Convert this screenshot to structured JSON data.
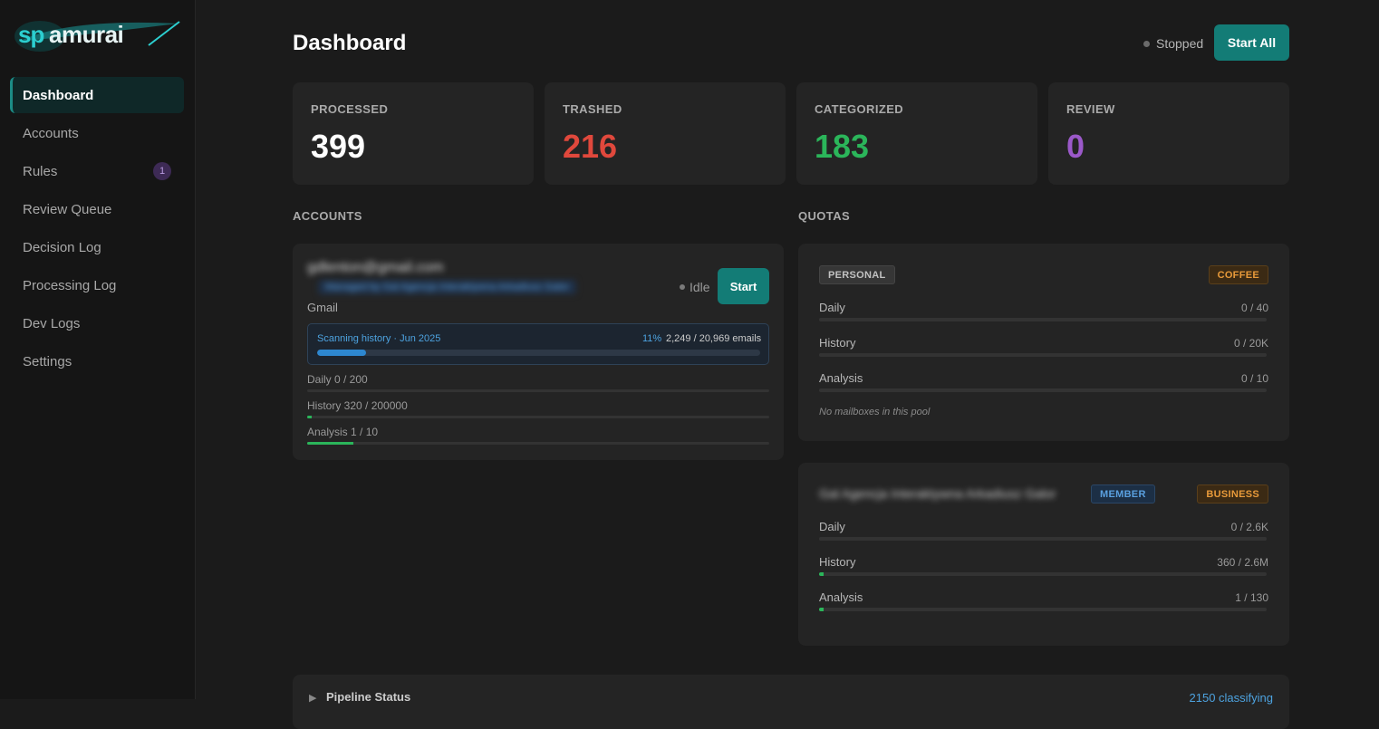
{
  "app": {
    "logo_text": "spamurai",
    "logo_primary": "#2ccfd0",
    "logo_secondary": "#e8f4f4"
  },
  "sidebar": {
    "items": [
      {
        "label": "Dashboard",
        "active": true
      },
      {
        "label": "Accounts"
      },
      {
        "label": "Rules",
        "badge": "1"
      },
      {
        "label": "Review Queue"
      },
      {
        "label": "Decision Log"
      },
      {
        "label": "Processing Log"
      },
      {
        "label": "Dev Logs"
      },
      {
        "label": "Settings"
      }
    ]
  },
  "header": {
    "title": "Dashboard",
    "status": "Stopped",
    "start_all_label": "Start All"
  },
  "stats": [
    {
      "label": "PROCESSED",
      "value": "399",
      "color": "#ffffff"
    },
    {
      "label": "TRASHED",
      "value": "216",
      "color": "#e0483c"
    },
    {
      "label": "CATEGORIZED",
      "value": "183",
      "color": "#2bb55a"
    },
    {
      "label": "REVIEW",
      "value": "0",
      "color": "#9b59c9"
    }
  ],
  "accounts_section": {
    "title": "ACCOUNTS",
    "account": {
      "email": "gdlenton@gmail.com",
      "managed_by": "Managed by Gal Agencja Interaktywna Arkadiusz Galor",
      "state": "Idle",
      "start_label": "Start",
      "provider": "Gmail",
      "scan": {
        "label": "Scanning history · Jun 2025",
        "percent_text": "11%",
        "progress": 0.11,
        "count_text": "2,249 / 20,969 emails"
      },
      "limits": [
        {
          "label": "Daily 0 / 200",
          "progress": 0
        },
        {
          "label": "History 320 / 200000",
          "progress": 0.0016
        },
        {
          "label": "Analysis 1 / 10",
          "progress": 0.1
        }
      ]
    }
  },
  "quotas_section": {
    "title": "QUOTAS",
    "pools": [
      {
        "tag": "PERSONAL",
        "plan": "COFFEE",
        "rows": [
          {
            "label": "Daily",
            "value": "0 / 40",
            "progress": 0
          },
          {
            "label": "History",
            "value": "0 / 20K",
            "progress": 0
          },
          {
            "label": "Analysis",
            "value": "0 / 10",
            "progress": 0
          }
        ],
        "note": "No mailboxes in this pool"
      },
      {
        "name": "Gal Agencja Interaktywna Arkadiusz Galor",
        "role": "MEMBER",
        "plan": "BUSINESS",
        "rows": [
          {
            "label": "Daily",
            "value": "0 / 2.6K",
            "progress": 0
          },
          {
            "label": "History",
            "value": "360 / 2.6M",
            "progress": 0.0001
          },
          {
            "label": "Analysis",
            "value": "1 / 130",
            "progress": 0.0077
          }
        ]
      }
    ]
  },
  "pipeline": {
    "arrow_icon": "triangle-right-icon",
    "label": "Pipeline Status",
    "summary": "2150 classifying"
  }
}
